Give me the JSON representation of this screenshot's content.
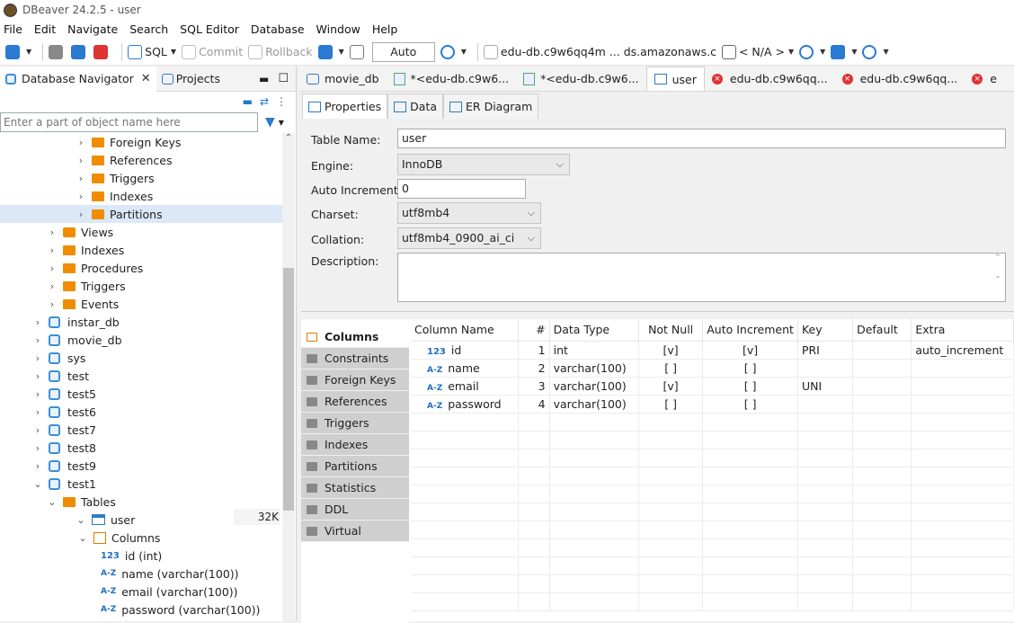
{
  "window": {
    "title": "DBeaver 24.2.5 - user"
  },
  "menu": [
    "File",
    "Edit",
    "Navigate",
    "Search",
    "SQL Editor",
    "Database",
    "Window",
    "Help"
  ],
  "toolbar": {
    "sql_label": "SQL",
    "commit_label": "Commit",
    "rollback_label": "Rollback",
    "auto_label": "Auto",
    "connection_label": "edu-db.c9w6qq4m ... ds.amazonaws.c",
    "schema_label": "< N/A >"
  },
  "left_panel": {
    "tab_navigator": "Database Navigator",
    "tab_projects": "Projects",
    "filter_placeholder": "Enter a part of object name here",
    "tree": [
      {
        "label": "Foreign Keys",
        "type": "folder",
        "level": 4
      },
      {
        "label": "References",
        "type": "folder",
        "level": 4
      },
      {
        "label": "Triggers",
        "type": "folder",
        "level": 4
      },
      {
        "label": "Indexes",
        "type": "folder",
        "level": 4
      },
      {
        "label": "Partitions",
        "type": "folder",
        "level": 4,
        "selected": true
      },
      {
        "label": "Views",
        "type": "views",
        "level": 3
      },
      {
        "label": "Indexes",
        "type": "folder",
        "level": 3
      },
      {
        "label": "Procedures",
        "type": "folder",
        "level": 3
      },
      {
        "label": "Triggers",
        "type": "folder",
        "level": 3
      },
      {
        "label": "Events",
        "type": "folder",
        "level": 3
      },
      {
        "label": "instar_db",
        "type": "db",
        "level": 2
      },
      {
        "label": "movie_db",
        "type": "db",
        "level": 2
      },
      {
        "label": "sys",
        "type": "db",
        "level": 2
      },
      {
        "label": "test",
        "type": "db",
        "level": 2
      },
      {
        "label": "test5",
        "type": "db",
        "level": 2
      },
      {
        "label": "test6",
        "type": "db",
        "level": 2
      },
      {
        "label": "test7",
        "type": "db",
        "level": 2
      },
      {
        "label": "test8",
        "type": "db",
        "level": 2
      },
      {
        "label": "test9",
        "type": "db",
        "level": 2
      },
      {
        "label": "test1",
        "type": "db",
        "level": 2,
        "expanded": true
      },
      {
        "label": "Tables",
        "type": "tables",
        "level": 3,
        "expanded": true
      },
      {
        "label": "user",
        "type": "table",
        "level": 4,
        "expanded": true
      },
      {
        "label": "Columns",
        "type": "columns",
        "level": 5,
        "expanded": true
      },
      {
        "label": "id (int)",
        "type": "num",
        "level": 6
      },
      {
        "label": "name (varchar(100))",
        "type": "text",
        "level": 6
      },
      {
        "label": "email (varchar(100))",
        "type": "text",
        "level": 6
      },
      {
        "label": "password (varchar(100))",
        "type": "text",
        "level": 6
      }
    ],
    "user_size": "32K"
  },
  "editor_tabs": [
    {
      "label": "movie_db",
      "kind": "db"
    },
    {
      "label": "*<edu-db.c9w6...",
      "kind": "sql"
    },
    {
      "label": "*<edu-db.c9w6...",
      "kind": "sql"
    },
    {
      "label": "user",
      "kind": "table",
      "active": true
    },
    {
      "label": "edu-db.c9w6qq...",
      "kind": "error"
    },
    {
      "label": "edu-db.c9w6qq...",
      "kind": "error"
    },
    {
      "label": "e",
      "kind": "error"
    }
  ],
  "sub_tabs": [
    "Properties",
    "Data",
    "ER Diagram"
  ],
  "properties": {
    "table_name_label": "Table Name:",
    "table_name": "user",
    "engine_label": "Engine:",
    "engine": "InnoDB",
    "auto_increment_label": "Auto Increment:",
    "auto_increment": "0",
    "charset_label": "Charset:",
    "charset": "utf8mb4",
    "collation_label": "Collation:",
    "collation": "utf8mb4_0900_ai_ci",
    "description_label": "Description:"
  },
  "side_tabs": [
    "Columns",
    "Constraints",
    "Foreign Keys",
    "References",
    "Triggers",
    "Indexes",
    "Partitions",
    "Statistics",
    "DDL",
    "Virtual"
  ],
  "columns_table": {
    "headers": [
      "Column Name",
      "#",
      "Data Type",
      "Not Null",
      "Auto Increment",
      "Key",
      "Default",
      "Extra"
    ],
    "rows": [
      {
        "name": "id",
        "icon": "123",
        "pos": "1",
        "type": "int",
        "notnull": "[v]",
        "autoinc": "[v]",
        "key": "PRI",
        "default": "",
        "extra": "auto_increment"
      },
      {
        "name": "name",
        "icon": "A-Z",
        "pos": "2",
        "type": "varchar(100)",
        "notnull": "[ ]",
        "autoinc": "[ ]",
        "key": "",
        "default": "",
        "extra": ""
      },
      {
        "name": "email",
        "icon": "A-Z",
        "pos": "3",
        "type": "varchar(100)",
        "notnull": "[v]",
        "autoinc": "[ ]",
        "key": "UNI",
        "default": "",
        "extra": ""
      },
      {
        "name": "password",
        "icon": "A-Z",
        "pos": "4",
        "type": "varchar(100)",
        "notnull": "[ ]",
        "autoinc": "[ ]",
        "key": "",
        "default": "",
        "extra": ""
      }
    ]
  }
}
